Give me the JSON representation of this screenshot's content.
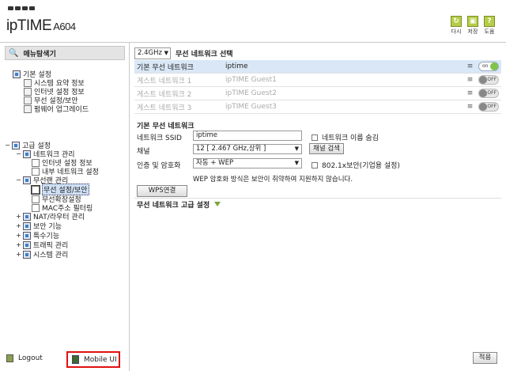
{
  "header": {
    "brand": "ipTIME",
    "model": "A604",
    "buttons": [
      {
        "label": "다시",
        "icon": "refresh-icon"
      },
      {
        "label": "저장",
        "icon": "save-icon"
      },
      {
        "label": "도움",
        "icon": "help-icon"
      }
    ]
  },
  "sidebar": {
    "title": "메뉴탐색기",
    "basic": {
      "label": "기본 설정",
      "items": [
        "시스템 요약 정보",
        "인터넷 설정 정보",
        "무선 설정/보안",
        "펌웨어 업그레이드"
      ]
    },
    "advanced": {
      "label": "고급 설정",
      "network": {
        "label": "네트워크 관리",
        "items": [
          "인터넷 설정 정보",
          "내부 네트워크 설정"
        ]
      },
      "wireless": {
        "label": "무선랜 관리",
        "items": [
          "무선 설정/보안",
          "무선확장설정",
          "MAC주소 필터링"
        ]
      },
      "others": [
        "NAT/라우터 관리",
        "보안 기능",
        "특수기능",
        "트래픽 관리",
        "시스템 관리"
      ]
    },
    "logout": "Logout",
    "mobile_ui": "Mobile UI"
  },
  "main": {
    "band": "2.4GHz",
    "title": "무선 네트워크 선택",
    "networks": [
      {
        "name": "기본 무선 네트워크",
        "ssid": "iptime",
        "state": "on"
      },
      {
        "name": "게스트 네트워크 1",
        "ssid": "ipTIME Guest1",
        "state": "off"
      },
      {
        "name": "게스트 네트워크 2",
        "ssid": "ipTIME Guest2",
        "state": "off"
      },
      {
        "name": "게스트 네트워크 3",
        "ssid": "ipTIME Guest3",
        "state": "off"
      }
    ],
    "toggle_on": "on",
    "toggle_off": "OFF",
    "section_title": "기본 무선 네트워크",
    "form": {
      "ssid_label": "네트워크 SSID",
      "ssid_value": "iptime",
      "hide_label": "네트워크 이름 숨김",
      "channel_label": "채널",
      "channel_value": "12 [ 2.467 GHz,상위 ]",
      "channel_search": "채널 검색",
      "auth_label": "인증 및 암호화",
      "auth_value": "자동 + WEP",
      "enterprise_label": "802.1x보안(기업용 설정)",
      "wep_note": "WEP 암호화 방식은 보안이 취약하여 지원하지 않습니다.",
      "wps_button": "WPS연결"
    },
    "advanced_label": "무선 네트워크 고급 설정",
    "apply": "적용"
  },
  "colors": {
    "accent_green": "#7ec34a",
    "selected_row": "#d9e7f6",
    "mobile_highlight": "#e01010"
  }
}
